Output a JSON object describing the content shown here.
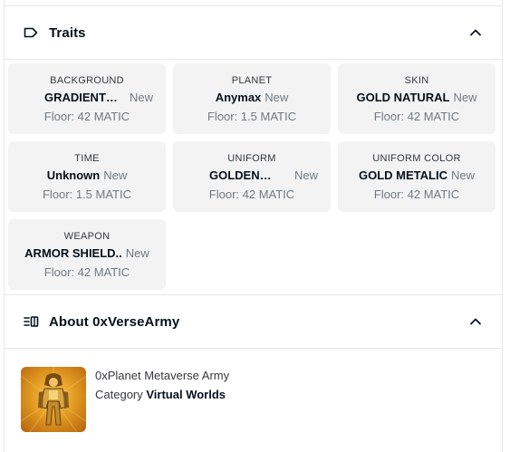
{
  "traits_section": {
    "title": "Traits",
    "items": [
      {
        "type": "BACKGROUND",
        "value": "GRADIENT…",
        "badge": "New",
        "floor": "Floor: 42 MATIC"
      },
      {
        "type": "PLANET",
        "value": "Anymax",
        "badge": "New",
        "floor": "Floor: 1.5 MATIC"
      },
      {
        "type": "SKIN",
        "value": "GOLD NATURAL",
        "badge": "New",
        "floor": "Floor: 42 MATIC"
      },
      {
        "type": "TIME",
        "value": "Unknown",
        "badge": "New",
        "floor": "Floor: 1.5 MATIC"
      },
      {
        "type": "UNIFORM",
        "value": "GOLDEN…",
        "badge": "New",
        "floor": "Floor: 42 MATIC"
      },
      {
        "type": "UNIFORM COLOR",
        "value": "GOLD METALIC",
        "badge": "New",
        "floor": "Floor: 42 MATIC"
      },
      {
        "type": "WEAPON",
        "value": "ARMOR SHIELD..",
        "badge": "New",
        "floor": "Floor: 42 MATIC"
      }
    ]
  },
  "about_section": {
    "title": "About 0xVerseArmy",
    "description": "0xPlanet Metaverse Army",
    "category_label": "Category",
    "category_value": "Virtual Worlds"
  },
  "icons": {
    "traits": "tag-icon",
    "about": "list-icon",
    "collapse": "chevron-up-icon"
  },
  "colors": {
    "card_bg": "#f3f3f3",
    "border": "#e5e8eb",
    "text_primary": "#04111d",
    "text_secondary": "#707a83"
  }
}
